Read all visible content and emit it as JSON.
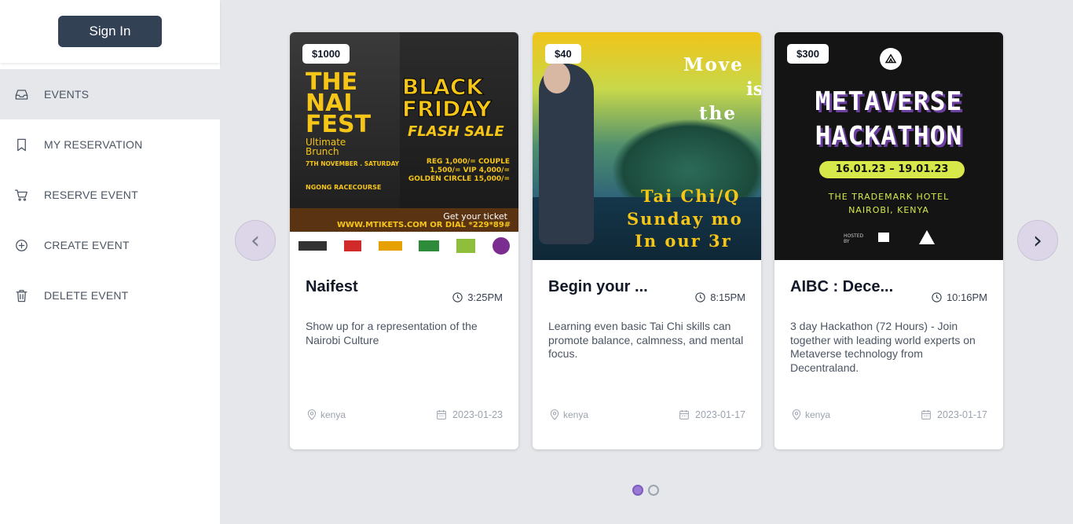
{
  "sidebar": {
    "signin_label": "Sign In",
    "items": [
      {
        "label": "EVENTS",
        "icon": "inbox-icon"
      },
      {
        "label": "MY RESERVATION",
        "icon": "bookmark-icon"
      },
      {
        "label": "RESERVE EVENT",
        "icon": "cart-icon"
      },
      {
        "label": "CREATE EVENT",
        "icon": "plus-circle-icon"
      },
      {
        "label": "DELETE EVENT",
        "icon": "trash-icon"
      }
    ]
  },
  "carousel": {
    "prev_icon": "‹",
    "next_icon": "›",
    "cards": [
      {
        "price": "$1000",
        "title": "Naifest",
        "time": "3:25PM",
        "description": "Show up for a representation of the Nairobi Culture",
        "location": "kenya",
        "date": "2023-01-23",
        "poster": {
          "line1": "THE",
          "line2": "NAI",
          "line3": "FEST",
          "sub": "Ultimate Brunch",
          "promo1": "BLACK",
          "promo2": "FRIDAY",
          "promo3": "FLASH SALE",
          "when": "7TH NOVEMBER . SATURDAY",
          "where": "NGONG RACECOURSE",
          "tiers": "REG 1,000/= COUPLE 1,500/= VIP 4,000/= GOLDEN CIRCLE 15,000/=",
          "ticket": "Get your ticket",
          "site": "WWW.MTIKETS.COM  OR DIAL *229*89#"
        }
      },
      {
        "price": "$40",
        "title": "Begin your ...",
        "time": "8:15PM",
        "description": "Learning even basic Tai Chi skills can promote balance, calmness, and mental focus.",
        "location": "kenya",
        "date": "2023-01-17",
        "poster": {
          "line1": "Move",
          "line2": "is",
          "line3": "the",
          "bottom1": "Tai Chi/Q",
          "bottom2": "Sunday mo",
          "bottom3": "In our 3r"
        }
      },
      {
        "price": "$300",
        "title": "AIBC : Dece...",
        "time": "10:16PM",
        "description": "3 day Hackathon (72 Hours) - Join together with leading world experts on Metaverse technology from Decentraland.",
        "location": "kenya",
        "date": "2023-01-17",
        "poster": {
          "line1": "METAVERSE",
          "line2": "HACKATHON",
          "dates": "16.01.23 – 19.01.23",
          "venue1": "THE TRADEMARK HOTEL",
          "venue2": "NAIROBI, KENYA",
          "hosted": "HOSTED BY"
        }
      }
    ],
    "pagination": {
      "count": 2,
      "active": 0
    }
  },
  "colors": {
    "signin_bg": "#334155",
    "page_bg": "#e5e7eb",
    "dot_active": "#9b7ad6"
  }
}
